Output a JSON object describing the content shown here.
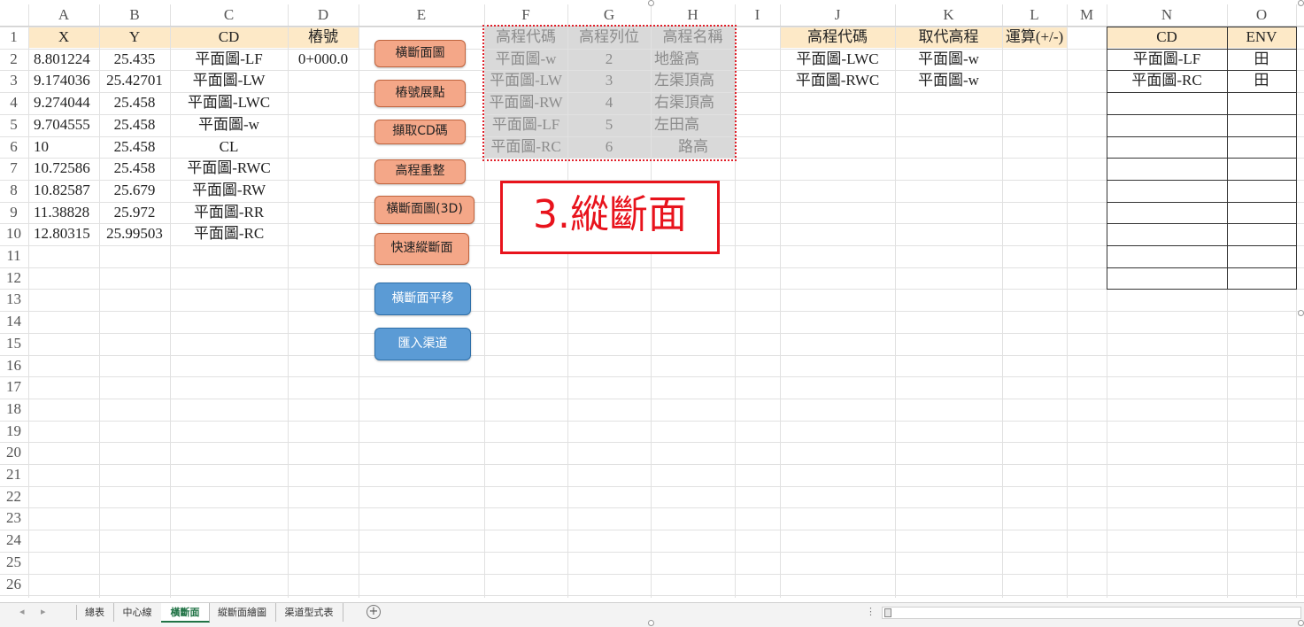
{
  "columns": [
    "A",
    "B",
    "C",
    "D",
    "E",
    "F",
    "G",
    "H",
    "I",
    "J",
    "K",
    "L",
    "M",
    "N",
    "O"
  ],
  "rows": [
    "1",
    "2",
    "3",
    "4",
    "5",
    "6",
    "7",
    "8",
    "9",
    "10",
    "11",
    "12",
    "13",
    "14",
    "15",
    "16",
    "17",
    "18",
    "19",
    "20",
    "21",
    "22",
    "23",
    "24",
    "25",
    "26"
  ],
  "table_a": {
    "headers": [
      "X",
      "Y",
      "CD",
      "樁號"
    ],
    "rows": [
      [
        "8.801224",
        "25.435",
        "平面圖-LF",
        "0+000.0"
      ],
      [
        "9.174036",
        "25.42701",
        "平面圖-LW",
        ""
      ],
      [
        "9.274044",
        "25.458",
        "平面圖-LWC",
        ""
      ],
      [
        "9.704555",
        "25.458",
        "平面圖-w",
        ""
      ],
      [
        "10",
        "25.458",
        "CL",
        ""
      ],
      [
        "10.72586",
        "25.458",
        "平面圖-RWC",
        ""
      ],
      [
        "10.82587",
        "25.679",
        "平面圖-RW",
        ""
      ],
      [
        "11.38828",
        "25.972",
        "平面圖-RR",
        ""
      ],
      [
        "12.80315",
        "25.99503",
        "平面圖-RC",
        ""
      ]
    ]
  },
  "table_f": {
    "headers": [
      "高程代碼",
      "高程列位",
      "高程名稱"
    ],
    "rows": [
      [
        "平面圖-w",
        "2",
        "地盤高"
      ],
      [
        "平面圖-LW",
        "3",
        "左渠頂高"
      ],
      [
        "平面圖-RW",
        "4",
        "右渠頂高"
      ],
      [
        "平面圖-LF",
        "5",
        "左田高"
      ],
      [
        "平面圖-RC",
        "6",
        "路高"
      ]
    ]
  },
  "table_j": {
    "headers": [
      "高程代碼",
      "取代高程",
      "運算(+/-)"
    ],
    "rows": [
      [
        "平面圖-LWC",
        "平面圖-w",
        ""
      ],
      [
        "平面圖-RWC",
        "平面圖-w",
        ""
      ]
    ]
  },
  "table_n": {
    "headers": [
      "CD",
      "ENV"
    ],
    "rows": [
      [
        "平面圖-LF",
        "田"
      ],
      [
        "平面圖-RC",
        "田"
      ]
    ]
  },
  "buttons": {
    "b1": "橫斷面圖",
    "b2": "樁號展點",
    "b3": "擷取CD碼",
    "b4": "高程重整",
    "b5": "橫斷面圖(3D)",
    "b6": "快速縱斷面",
    "b7": "橫斷面平移",
    "b8": "匯入渠道"
  },
  "callout": "3.縱斷面",
  "tabs": [
    "總表",
    "中心線",
    "橫斷面",
    "縱斷面繪圖",
    "渠道型式表"
  ],
  "active_tab": "橫斷面",
  "add_sheet_icon": "plus-circle-icon",
  "colors": {
    "header_fill": "#fde9c7",
    "gray_fill": "#d9d9d9",
    "button_orange": "#f4a788",
    "button_blue": "#5b9bd5",
    "callout_red": "#e8131c",
    "tab_green": "#217346"
  }
}
